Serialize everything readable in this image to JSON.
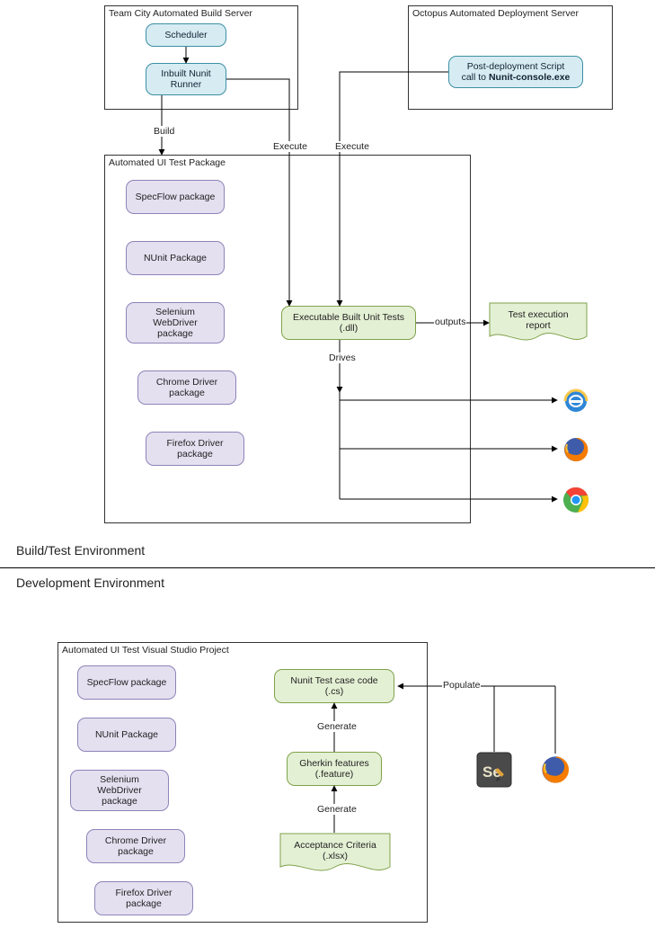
{
  "sections": {
    "build_env": "Build/Test Environment",
    "dev_env": "Development Environment"
  },
  "containers": {
    "teamcity": "Team City Automated Build Server",
    "octopus": "Octopus Automated Deployment Server",
    "pkg": "Automated UI Test Package",
    "vsproj": "Automated UI Test Visual Studio Project"
  },
  "nodes": {
    "scheduler": "Scheduler",
    "nunit_runner1": "Inbuilt Nunit",
    "nunit_runner2": "Runner",
    "post_deploy1": "Post-deployment Script",
    "post_deploy2": "call to Nunit-console.exe",
    "specflow": "SpecFlow package",
    "nunit_pkg": "NUnit Package",
    "selenium_wd1": "Selenium",
    "selenium_wd2": "WebDriver",
    "selenium_wd3": "package",
    "chrome_drv1": "Chrome Driver",
    "chrome_drv2": "package",
    "firefox_drv1": "Firefox Driver",
    "firefox_drv2": "package",
    "exec_unit1": "Executable Built Unit Tests",
    "exec_unit2": "(.dll)",
    "test_report1": "Test execution",
    "test_report2": "report",
    "nunit_code1": "Nunit Test case code",
    "nunit_code2": "(.cs)",
    "gherkin1": "Gherkin features",
    "gherkin2": "(.feature)",
    "criteria1": "Acceptance Criteria",
    "criteria2": "(.xlsx)"
  },
  "edges": {
    "build": "Build",
    "execute": "Execute",
    "outputs": "outputs",
    "drives": "Drives",
    "generate": "Generate",
    "populate": "Populate"
  },
  "icons": {
    "ie": "internet-explorer-icon",
    "firefox": "firefox-icon",
    "chrome": "chrome-icon",
    "selenium_ide": "selenium-ide-icon"
  }
}
